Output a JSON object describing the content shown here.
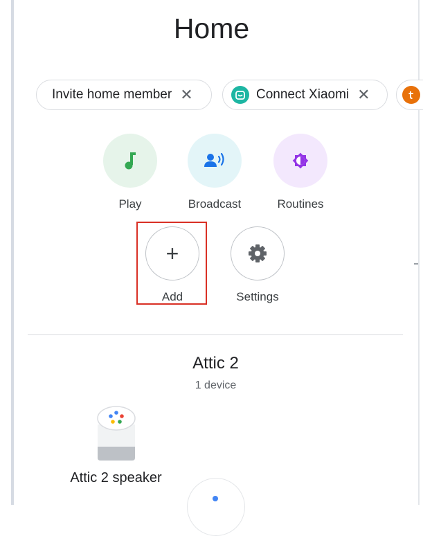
{
  "header": {
    "title": "Home"
  },
  "chips": [
    {
      "label": "Invite home member",
      "close": "✕"
    },
    {
      "label": "Connect Xiaomi",
      "close": "✕",
      "icon": "xiaomi-icon",
      "icon_color": "#1db6a3"
    },
    {
      "icon": "third-party-icon",
      "icon_color": "#e8710a"
    }
  ],
  "actions": {
    "play": {
      "label": "Play",
      "icon": "music-note-icon",
      "color": "#34a853",
      "bg": "#e6f4ea"
    },
    "broadcast": {
      "label": "Broadcast",
      "icon": "broadcast-icon",
      "color": "#1a73e8",
      "bg": "#e3f5f8"
    },
    "routines": {
      "label": "Routines",
      "icon": "brightness-icon",
      "color": "#9334e6",
      "bg": "#f3e8fd"
    },
    "add": {
      "label": "Add",
      "symbol": "+",
      "highlight_color": "#d93025"
    },
    "settings": {
      "label": "Settings",
      "icon": "gear-icon"
    }
  },
  "room": {
    "name": "Attic 2",
    "count": "1 device",
    "devices": [
      {
        "label": "Attic 2 speaker",
        "icon": "smart-speaker-icon"
      }
    ]
  }
}
